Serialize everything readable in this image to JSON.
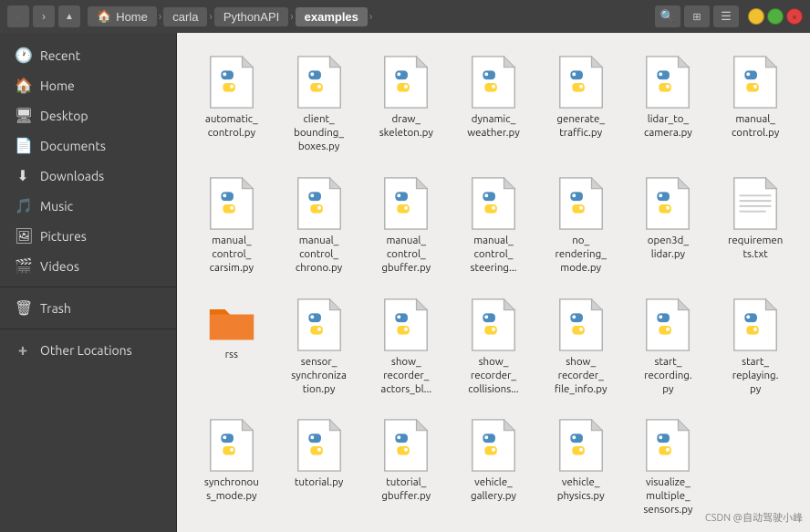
{
  "titlebar": {
    "back_btn": "‹",
    "forward_btn": "›",
    "up_btn": "↑",
    "breadcrumb": [
      {
        "label": "Home",
        "icon": "🏠",
        "active": false
      },
      {
        "label": "carla",
        "active": false
      },
      {
        "label": "PythonAPI",
        "active": false
      },
      {
        "label": "examples",
        "active": true
      }
    ],
    "search_btn": "🔍",
    "view_btn": "⊞",
    "menu_btn": "☰",
    "minimize_label": "−",
    "maximize_label": "+",
    "close_label": "×"
  },
  "sidebar": {
    "items": [
      {
        "id": "recent",
        "icon": "🕐",
        "label": "Recent",
        "active": false
      },
      {
        "id": "home",
        "icon": "🏠",
        "label": "Home",
        "active": false
      },
      {
        "id": "desktop",
        "icon": "🖥",
        "label": "Desktop",
        "active": false
      },
      {
        "id": "documents",
        "icon": "📄",
        "label": "Documents",
        "active": false
      },
      {
        "id": "downloads",
        "icon": "⬇",
        "label": "Downloads",
        "active": false
      },
      {
        "id": "music",
        "icon": "🎵",
        "label": "Music",
        "active": false
      },
      {
        "id": "pictures",
        "icon": "🖼",
        "label": "Pictures",
        "active": false
      },
      {
        "id": "videos",
        "icon": "🎬",
        "label": "Videos",
        "active": false
      },
      {
        "id": "trash",
        "icon": "🗑",
        "label": "Trash",
        "active": false
      },
      {
        "id": "other",
        "icon": "+",
        "label": "Other Locations",
        "active": false,
        "is_add": true
      }
    ]
  },
  "files": [
    {
      "name": "automatic_\ncontrol.py",
      "type": "python"
    },
    {
      "name": "client_\nbounding_\nboxes.py",
      "type": "python"
    },
    {
      "name": "draw_\nskeleton.py",
      "type": "python"
    },
    {
      "name": "dynamic_\nweather.py",
      "type": "python"
    },
    {
      "name": "generate_\ntraffic.py",
      "type": "python"
    },
    {
      "name": "lidar_to_\ncamera.py",
      "type": "python"
    },
    {
      "name": "manual_\ncontrol.py",
      "type": "python"
    },
    {
      "name": "manual_\ncontrol_\ncarsim.py",
      "type": "python"
    },
    {
      "name": "manual_\ncontrol_\nchrono.py",
      "type": "python"
    },
    {
      "name": "manual_\ncontrol_\ngbuffer.py",
      "type": "python"
    },
    {
      "name": "manual_\ncontrol_\nsteering...",
      "type": "python"
    },
    {
      "name": "no_\nrendering_\nmode.py",
      "type": "python"
    },
    {
      "name": "open3d_\nlidar.py",
      "type": "python"
    },
    {
      "name": "requiremen\nts.txt",
      "type": "text"
    },
    {
      "name": "rss",
      "type": "folder"
    },
    {
      "name": "sensor_\nsynchroniza\ntion.py",
      "type": "python"
    },
    {
      "name": "show_\nrecorder_\nactors_bl...",
      "type": "python"
    },
    {
      "name": "show_\nrecorder_\ncollisions...",
      "type": "python"
    },
    {
      "name": "show_\nrecorder_\nfile_info.py",
      "type": "python"
    },
    {
      "name": "start_\nrecording.\npy",
      "type": "python"
    },
    {
      "name": "start_\nreplaying.\npy",
      "type": "python"
    },
    {
      "name": "synchronou\ns_mode.py",
      "type": "python"
    },
    {
      "name": "tutorial.py",
      "type": "python"
    },
    {
      "name": "tutorial_\ngbuffer.py",
      "type": "python"
    },
    {
      "name": "vehicle_\ngallery.py",
      "type": "python"
    },
    {
      "name": "vehicle_\nphysics.py",
      "type": "python"
    },
    {
      "name": "visualize_\nmultiple_\nsensors.py",
      "type": "python"
    }
  ],
  "watermark": "CSDN @自动驾驶小峰"
}
